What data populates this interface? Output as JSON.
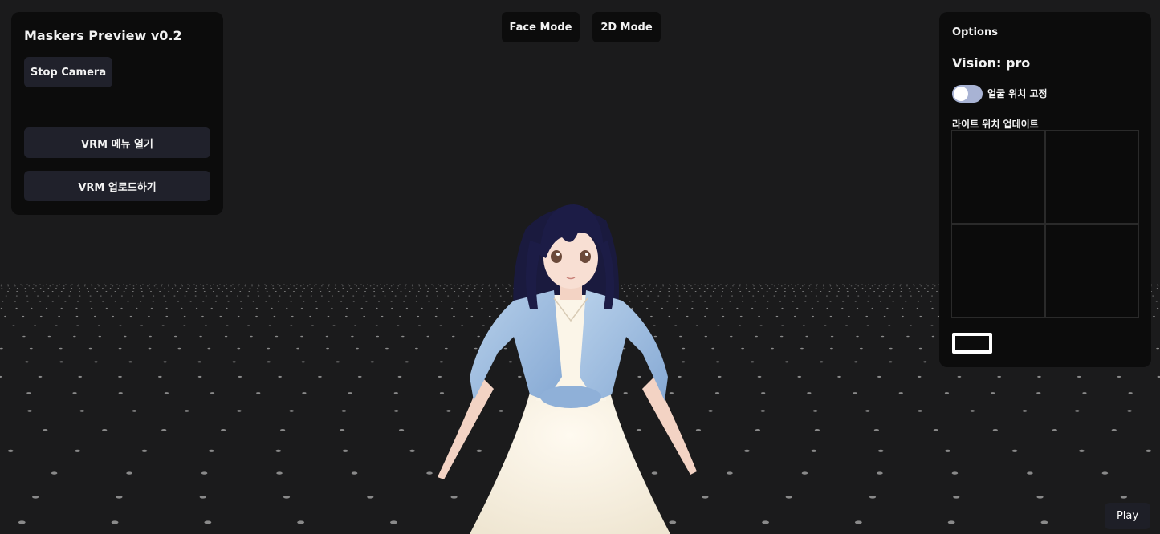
{
  "left_panel": {
    "title": "Maskers Preview v0.2",
    "stop_camera_label": "Stop Camera",
    "vrm_menu_label": "VRM 메뉴 열기",
    "vrm_upload_label": "VRM 업로드하기"
  },
  "top_buttons": {
    "face_mode_label": "Face Mode",
    "mode_2d_label": "2D Mode"
  },
  "options_panel": {
    "title": "Options",
    "vision_label": "Vision: pro",
    "toggle_label": "얼굴 위치 고정",
    "toggle_on": false,
    "light_section_title": "라이트 위치 업데이트"
  },
  "play_label": "Play",
  "colors": {
    "background": "#1b1b1c",
    "panel": "#0c0c0c",
    "button": "#20212b",
    "toggle_track": "#a8b3d4"
  },
  "icons": [
    "toggle-switch"
  ]
}
